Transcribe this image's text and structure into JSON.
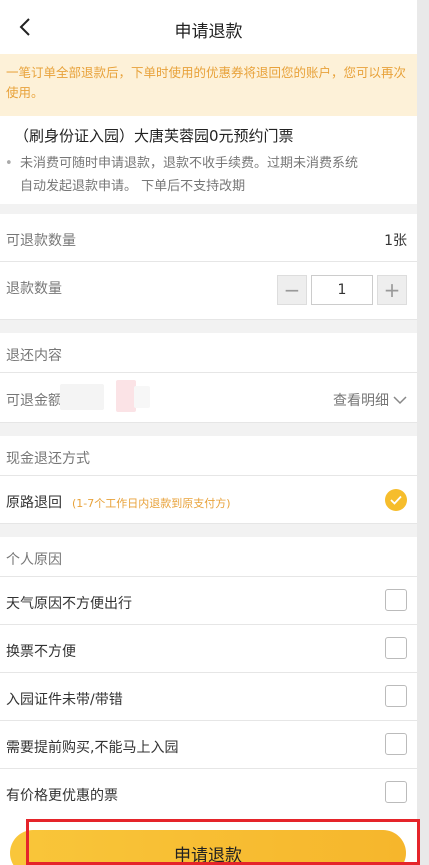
{
  "header": {
    "title": "申请退款",
    "back_icon": "chevron-left-icon"
  },
  "notice": {
    "text": "一笔订单全部退款后，下单时使用的优惠券将退回您的账户，您可以再次使用。"
  },
  "product": {
    "title": "（刷身份证入园）大唐芙蓉园0元预约门票",
    "note_line1": "未消费可随时申请退款，退款不收手续费。过期未消费系统",
    "note_line2": "自动发起退款申请。 下单后不支持改期"
  },
  "refundable_qty": {
    "label": "可退款数量",
    "value": "1张"
  },
  "refund_qty": {
    "label": "退款数量",
    "minus": "−",
    "value": "1",
    "plus": "+"
  },
  "refund_content": {
    "label": "退还内容"
  },
  "refund_amount": {
    "label": "可退金额",
    "view_detail": "查看明细"
  },
  "cash_method": {
    "label": "现金退还方式"
  },
  "original_route": {
    "label": "原路退回",
    "hint": "(1-7个工作日内退款到原支付方)"
  },
  "reasons": {
    "label": "个人原因",
    "items": [
      {
        "text": "天气原因不方便出行"
      },
      {
        "text": "换票不方便"
      },
      {
        "text": "入园证件未带/带错"
      },
      {
        "text": "需要提前购买,不能马上入园"
      },
      {
        "text": "有价格更优惠的票"
      }
    ]
  },
  "submit": {
    "label": "申请退款"
  },
  "colors": {
    "accent": "#f6bd2c",
    "notice_bg": "#fdf1d8",
    "notice_text": "#e8a23a",
    "highlight": "#e5242a"
  }
}
